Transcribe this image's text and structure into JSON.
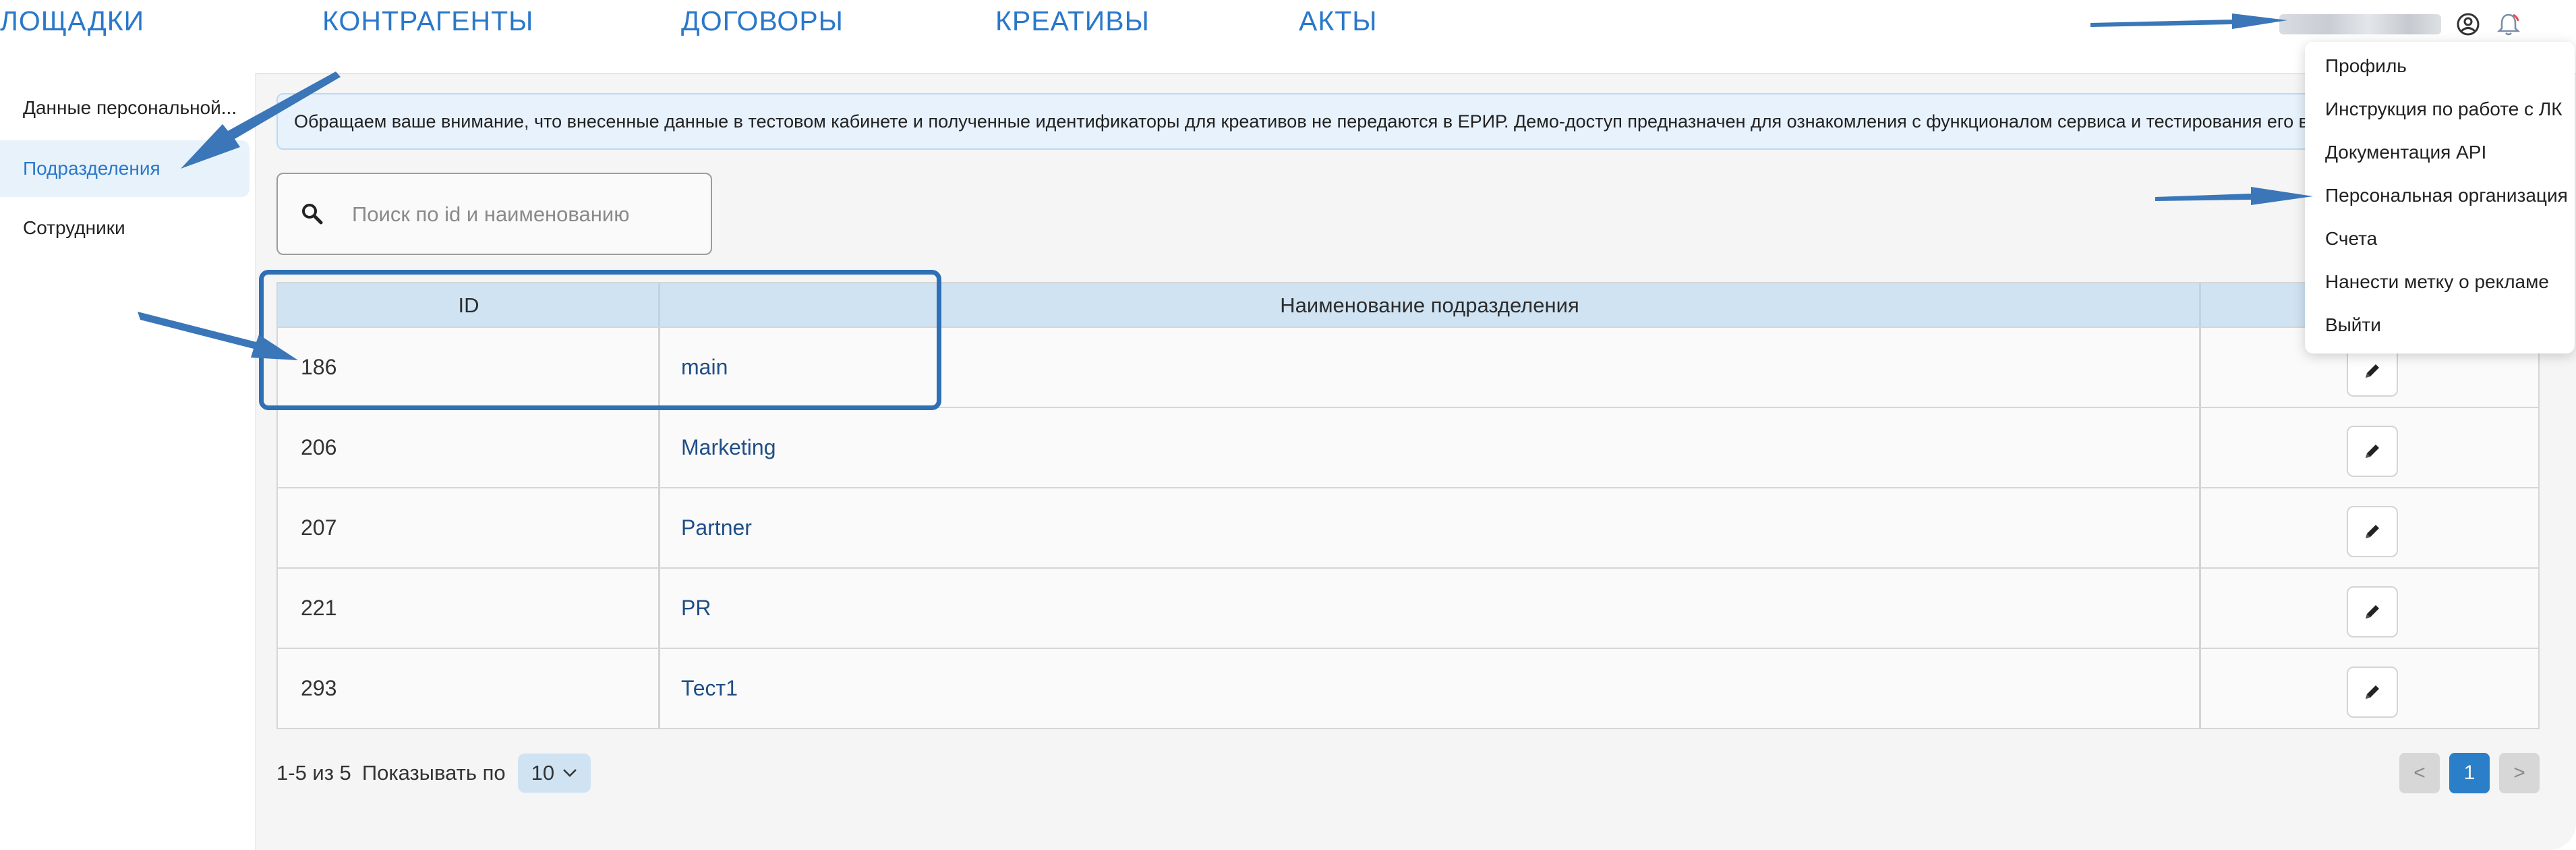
{
  "nav": {
    "items": [
      "ЛОЩАДКИ",
      "КОНТРАГЕНТЫ",
      "ДОГОВОРЫ",
      "КРЕАТИВЫ",
      "АКТЫ"
    ]
  },
  "user_menu": {
    "items": [
      "Профиль",
      "Инструкция по работе с ЛК",
      "Документация API",
      "Персональная организация",
      "Счета",
      "Нанести метку о рекламе",
      "Выйти"
    ]
  },
  "sidebar": {
    "items": [
      "Данные персональной...",
      "Подразделения",
      "Сотрудники"
    ],
    "active": "Подразделения"
  },
  "notice": {
    "text": "Обращаем ваше внимание, что внесенные данные в тестовом кабинете и полученные идентификаторы для креативов не передаются в ЕРИР. Демо-доступ предназначен для ознакомления с функционалом сервиса и тестирования его возмож"
  },
  "search": {
    "placeholder": "Поиск по id и наименованию",
    "value": ""
  },
  "table": {
    "headers": [
      "ID",
      "Наименование подразделения",
      ""
    ],
    "rows": [
      {
        "id": "186",
        "name": "main"
      },
      {
        "id": "206",
        "name": "Marketing"
      },
      {
        "id": "207",
        "name": "Partner"
      },
      {
        "id": "221",
        "name": "PR"
      },
      {
        "id": "293",
        "name": "Тест1"
      }
    ]
  },
  "footer": {
    "range": "1-5 из 5",
    "per_page_label": "Показывать по",
    "per_page_value": "10"
  },
  "pagination": {
    "prev": "<",
    "current": "1",
    "next": ">"
  },
  "icons": {
    "user": "user-circle-icon",
    "bell": "bell-icon",
    "search": "search-icon",
    "edit": "pencil-icon",
    "chevron": "chevron-down-icon"
  },
  "colors": {
    "accent": "#2a78c9",
    "annotation": "#2f6fb5",
    "header_bg": "#cfe3f3",
    "notice_bg": "#e7f2fc"
  }
}
